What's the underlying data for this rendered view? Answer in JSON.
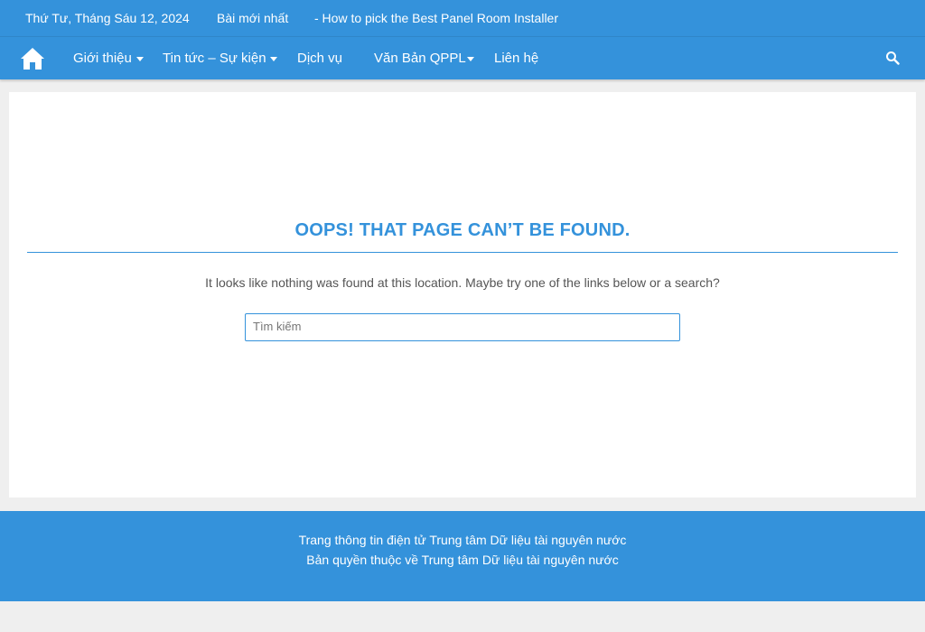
{
  "topbar": {
    "date": "Thứ Tư, Tháng Sáu 12, 2024",
    "latest_label": "Bài mới nhất",
    "ticker": "- How to pick the Best Panel Room Installer"
  },
  "nav": {
    "items": [
      {
        "label": "Giới thiệu"
      },
      {
        "label": "Tin tức – Sự kiện"
      },
      {
        "label": "Dịch vụ"
      },
      {
        "label": "Văn Bản QPPL"
      },
      {
        "label": "Liên hệ"
      }
    ]
  },
  "main": {
    "title": "OOPS! THAT PAGE CAN’T BE FOUND.",
    "message": "It looks like nothing was found at this location. Maybe try one of the links below or a search?",
    "search_placeholder": "Tìm kiếm"
  },
  "footer": {
    "line1": "Trang thông tin điện tử Trung tâm Dữ liệu tài nguyên nước",
    "line2": "Bản quyền thuộc về Trung tâm Dữ liệu tài nguyên nước"
  },
  "colors": {
    "accent": "#3492db",
    "background": "#efefef"
  },
  "icons": {
    "home": "home-icon",
    "search": "search-icon",
    "caret": "caret-down-icon"
  }
}
